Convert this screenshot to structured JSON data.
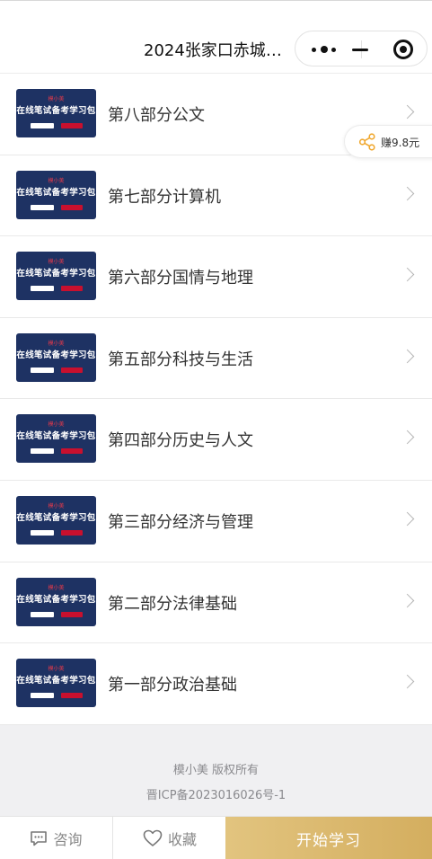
{
  "nav": {
    "title": "2024张家口赤城县..."
  },
  "earn": {
    "label": "赚9.8元"
  },
  "thumbnail": {
    "brand": "模小美",
    "headline": "在线笔试备考学习包",
    "subtitle": "",
    "btn_left": "",
    "btn_right": ""
  },
  "items": [
    {
      "title": "第八部分公文"
    },
    {
      "title": "第七部分计算机"
    },
    {
      "title": "第六部分国情与地理"
    },
    {
      "title": "第五部分科技与生活"
    },
    {
      "title": "第四部分历史与人文"
    },
    {
      "title": "第三部分经济与管理"
    },
    {
      "title": "第二部分法律基础"
    },
    {
      "title": "第一部分政治基础"
    }
  ],
  "footer": {
    "copyright": "模小美 版权所有",
    "icp": "晋ICP备2023016026号-1"
  },
  "bottom_bar": {
    "consult": "咨询",
    "collect": "收藏",
    "start": "开始学习"
  },
  "colors": {
    "accent_gold": "#d8b76c",
    "thumb_bg": "#1e3263",
    "brand_red": "#e6394a"
  }
}
